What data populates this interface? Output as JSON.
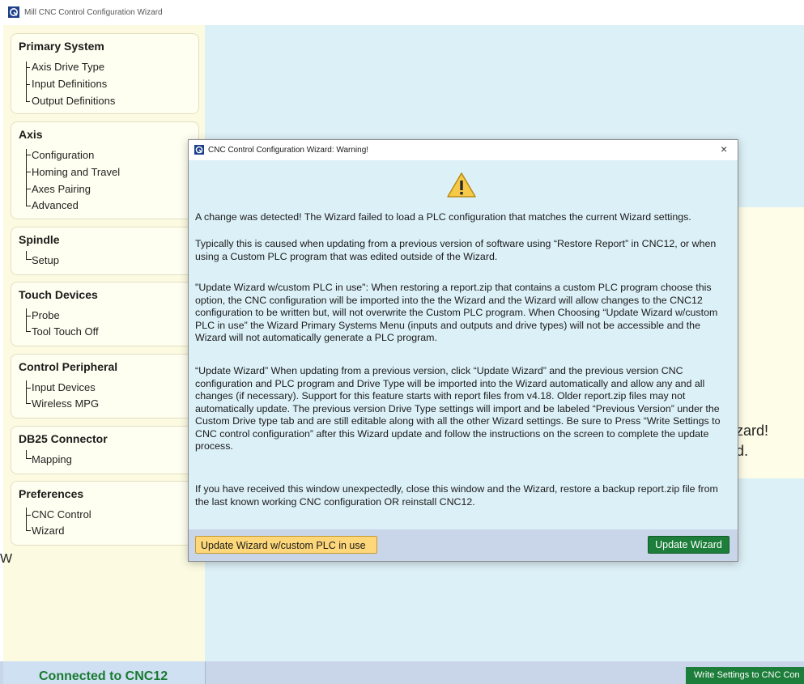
{
  "window": {
    "title": "Mill CNC Control Configuration Wizard"
  },
  "sidebar": {
    "groups": [
      {
        "title": "Primary System",
        "items": [
          "Axis Drive Type",
          "Input Definitions",
          "Output Definitions"
        ]
      },
      {
        "title": "Axis",
        "items": [
          "Configuration",
          "Homing and Travel",
          "Axes Pairing",
          "Advanced"
        ]
      },
      {
        "title": "Spindle",
        "items": [
          "Setup"
        ]
      },
      {
        "title": "Touch Devices",
        "items": [
          "Probe",
          "Tool Touch Off"
        ]
      },
      {
        "title": "Control Peripheral",
        "items": [
          "Input Devices",
          "Wireless MPG"
        ]
      },
      {
        "title": "DB25 Connector",
        "items": [
          "Mapping"
        ]
      },
      {
        "title": "Preferences",
        "items": [
          "CNC Control",
          "Wizard"
        ]
      }
    ]
  },
  "background": {
    "line1": "zard!",
    "line2": "d.",
    "stray": "W"
  },
  "status": {
    "connection": "Connected to CNC12",
    "write_button": "Write Settings to CNC Con"
  },
  "dialog": {
    "title": "CNC Control Configuration Wizard: Warning!",
    "close_label": "×",
    "paragraphs": [
      "A change was detected! The Wizard failed to load a PLC configuration that matches the current Wizard settings.",
      "Typically this is caused when updating from a previous version of software using “Restore Report” in CNC12, or when using a Custom PLC program that was edited outside of the Wizard.",
      "\"Update Wizard w/custom PLC in use\":  When restoring a report.zip that contains a custom PLC program choose this option, the CNC configuration will be imported into the the Wizard and the Wizard will allow changes to the CNC12 configuration to be written but, will not overwrite the Custom PLC program. When Choosing “Update Wizard w/custom PLC in use” the Wizard Primary Systems Menu (inputs and outputs and drive types) will not be accessible and the Wizard will not automatically generate a PLC program.",
      "“Update Wizard” When updating from a previous version, click “Update Wizard” and the previous version CNC configuration and PLC program and Drive Type will be imported into the Wizard automatically and allow any and all changes (if necessary). Support for this feature starts with report files from v4.18. Older report.zip files may not automatically update. The previous version Drive Type settings will import and be labeled “Previous Version” under the Custom Drive type tab and are still editable along with all the other Wizard settings. Be sure to Press “Write Settings to CNC control configuration” after this Wizard update and follow the instructions on the screen to complete the update process.",
      "If you have received this window unexpectedly, close this window and the Wizard, restore a backup report.zip file from the last known working CNC configuration OR reinstall CNC12."
    ],
    "buttons": {
      "custom_plc": "Update Wizard w/custom PLC in use",
      "update": "Update Wizard"
    }
  }
}
